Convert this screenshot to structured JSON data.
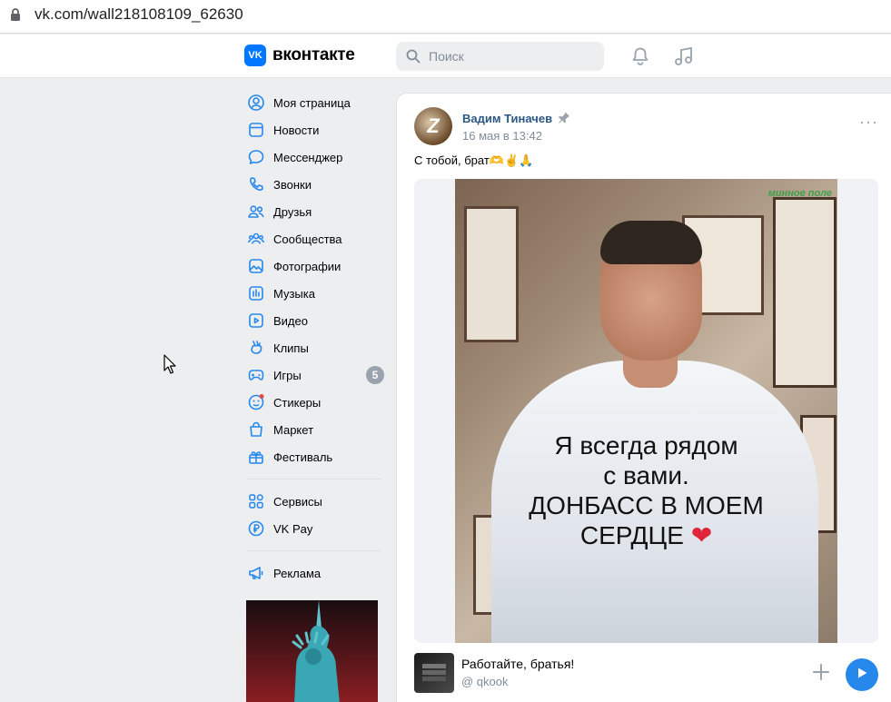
{
  "browser": {
    "url": "vk.com/wall218108109_62630"
  },
  "header": {
    "logo_mark": "VK",
    "logo_text": "вконтакте",
    "search_placeholder": "Поиск",
    "icons": [
      "search-icon",
      "bell-icon",
      "music-note-icon"
    ]
  },
  "menu": {
    "items": [
      {
        "label": "Моя страница",
        "icon": "user-circle-icon"
      },
      {
        "label": "Новости",
        "icon": "news-feed-icon"
      },
      {
        "label": "Мессенджер",
        "icon": "message-bubble-icon"
      },
      {
        "label": "Звонки",
        "icon": "phone-icon"
      },
      {
        "label": "Друзья",
        "icon": "friends-icon"
      },
      {
        "label": "Сообщества",
        "icon": "communities-icon"
      },
      {
        "label": "Фотографии",
        "icon": "photo-icon"
      },
      {
        "label": "Музыка",
        "icon": "music-icon"
      },
      {
        "label": "Видео",
        "icon": "video-icon"
      },
      {
        "label": "Клипы",
        "icon": "clips-icon"
      },
      {
        "label": "Игры",
        "icon": "gamepad-icon",
        "badge": "5"
      },
      {
        "label": "Стикеры",
        "icon": "sticker-icon"
      },
      {
        "label": "Маркет",
        "icon": "shopping-bag-icon"
      },
      {
        "label": "Фестиваль",
        "icon": "gift-icon"
      }
    ],
    "items2": [
      {
        "label": "Сервисы",
        "icon": "services-grid-icon"
      },
      {
        "label": "VK Pay",
        "icon": "ruble-icon"
      }
    ],
    "items3": [
      {
        "label": "Реклама",
        "icon": "megaphone-icon"
      }
    ]
  },
  "post": {
    "author": "Вадим Тиначев",
    "date": "16 мая в 13:42",
    "avatar_letter": "Z",
    "text": "С тобой, брат🫶✌️🙏",
    "image": {
      "watermark": "минное поле",
      "caption_lines": [
        "Я всегда рядом",
        "с вами.",
        "ДОНБАСС В МОЕМ",
        "СЕРДЦЕ"
      ]
    },
    "audio": {
      "title": "Работайте, братья!",
      "artist": "@ qkook"
    }
  },
  "colors": {
    "accent": "#0077ff",
    "link": "#2a5885",
    "play": "#2688eb",
    "secondary": "#818c99"
  }
}
